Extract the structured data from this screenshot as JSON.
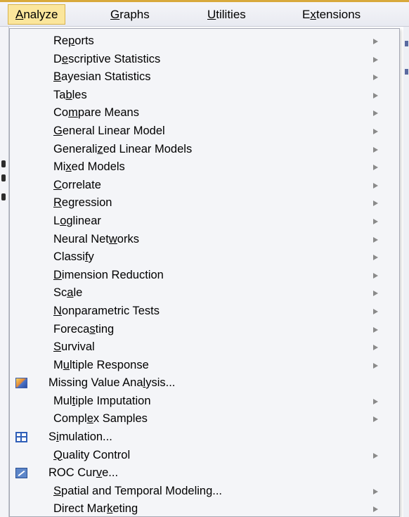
{
  "menubar": {
    "items": [
      {
        "pre": "",
        "key": "A",
        "post": "nalyze",
        "active": true
      },
      {
        "pre": "",
        "key": "G",
        "post": "raphs",
        "active": false
      },
      {
        "pre": "",
        "key": "U",
        "post": "tilities",
        "active": false
      },
      {
        "pre": "E",
        "key": "x",
        "post": "tensions",
        "active": false
      }
    ]
  },
  "dropdown": {
    "items": [
      {
        "pre": "Re",
        "key": "p",
        "post": "orts",
        "submenu": true,
        "icon": ""
      },
      {
        "pre": "D",
        "key": "e",
        "post": "scriptive Statistics",
        "submenu": true,
        "icon": ""
      },
      {
        "pre": "",
        "key": "B",
        "post": "ayesian Statistics",
        "submenu": true,
        "icon": ""
      },
      {
        "pre": "Ta",
        "key": "b",
        "post": "les",
        "submenu": true,
        "icon": ""
      },
      {
        "pre": "Co",
        "key": "m",
        "post": "pare Means",
        "submenu": true,
        "icon": ""
      },
      {
        "pre": "",
        "key": "G",
        "post": "eneral Linear Model",
        "submenu": true,
        "icon": ""
      },
      {
        "pre": "Generali",
        "key": "z",
        "post": "ed Linear Models",
        "submenu": true,
        "icon": ""
      },
      {
        "pre": "Mi",
        "key": "x",
        "post": "ed Models",
        "submenu": true,
        "icon": ""
      },
      {
        "pre": "",
        "key": "C",
        "post": "orrelate",
        "submenu": true,
        "icon": ""
      },
      {
        "pre": "",
        "key": "R",
        "post": "egression",
        "submenu": true,
        "icon": ""
      },
      {
        "pre": "L",
        "key": "o",
        "post": "glinear",
        "submenu": true,
        "icon": ""
      },
      {
        "pre": "Neural Net",
        "key": "w",
        "post": "orks",
        "submenu": true,
        "icon": ""
      },
      {
        "pre": "Classi",
        "key": "f",
        "post": "y",
        "submenu": true,
        "icon": ""
      },
      {
        "pre": "",
        "key": "D",
        "post": "imension Reduction",
        "submenu": true,
        "icon": ""
      },
      {
        "pre": "Sc",
        "key": "a",
        "post": "le",
        "submenu": true,
        "icon": ""
      },
      {
        "pre": "",
        "key": "N",
        "post": "onparametric Tests",
        "submenu": true,
        "icon": ""
      },
      {
        "pre": "Foreca",
        "key": "s",
        "post": "ting",
        "submenu": true,
        "icon": ""
      },
      {
        "pre": "",
        "key": "S",
        "post": "urvival",
        "submenu": true,
        "icon": ""
      },
      {
        "pre": "M",
        "key": "u",
        "post": "ltiple Response",
        "submenu": true,
        "icon": ""
      },
      {
        "pre": "Missing Value Ana",
        "key": "l",
        "post": "ysis...",
        "submenu": false,
        "icon": "missing-value-analysis-icon"
      },
      {
        "pre": "Mul",
        "key": "t",
        "post": "iple Imputation",
        "submenu": true,
        "icon": ""
      },
      {
        "pre": "Compl",
        "key": "e",
        "post": "x Samples",
        "submenu": true,
        "icon": ""
      },
      {
        "pre": "S",
        "key": "i",
        "post": "mulation...",
        "submenu": false,
        "icon": "simulation-icon"
      },
      {
        "pre": "",
        "key": "Q",
        "post": "uality Control",
        "submenu": true,
        "icon": ""
      },
      {
        "pre": "ROC Cur",
        "key": "v",
        "post": "e...",
        "submenu": false,
        "icon": "roc-curve-icon"
      },
      {
        "pre": "",
        "key": "S",
        "post": "patial and Temporal Modeling...",
        "submenu": true,
        "icon": ""
      },
      {
        "pre": "Direct Mar",
        "key": "k",
        "post": "eting",
        "submenu": true,
        "icon": ""
      }
    ]
  },
  "colors": {
    "menubar_bg": "#eef0f5",
    "menubar_accent": "#d8a93b",
    "active_item_bg": "#fbe69c",
    "dropdown_bg": "#f4f5f8",
    "submenu_arrow": "#8a8a8a"
  }
}
